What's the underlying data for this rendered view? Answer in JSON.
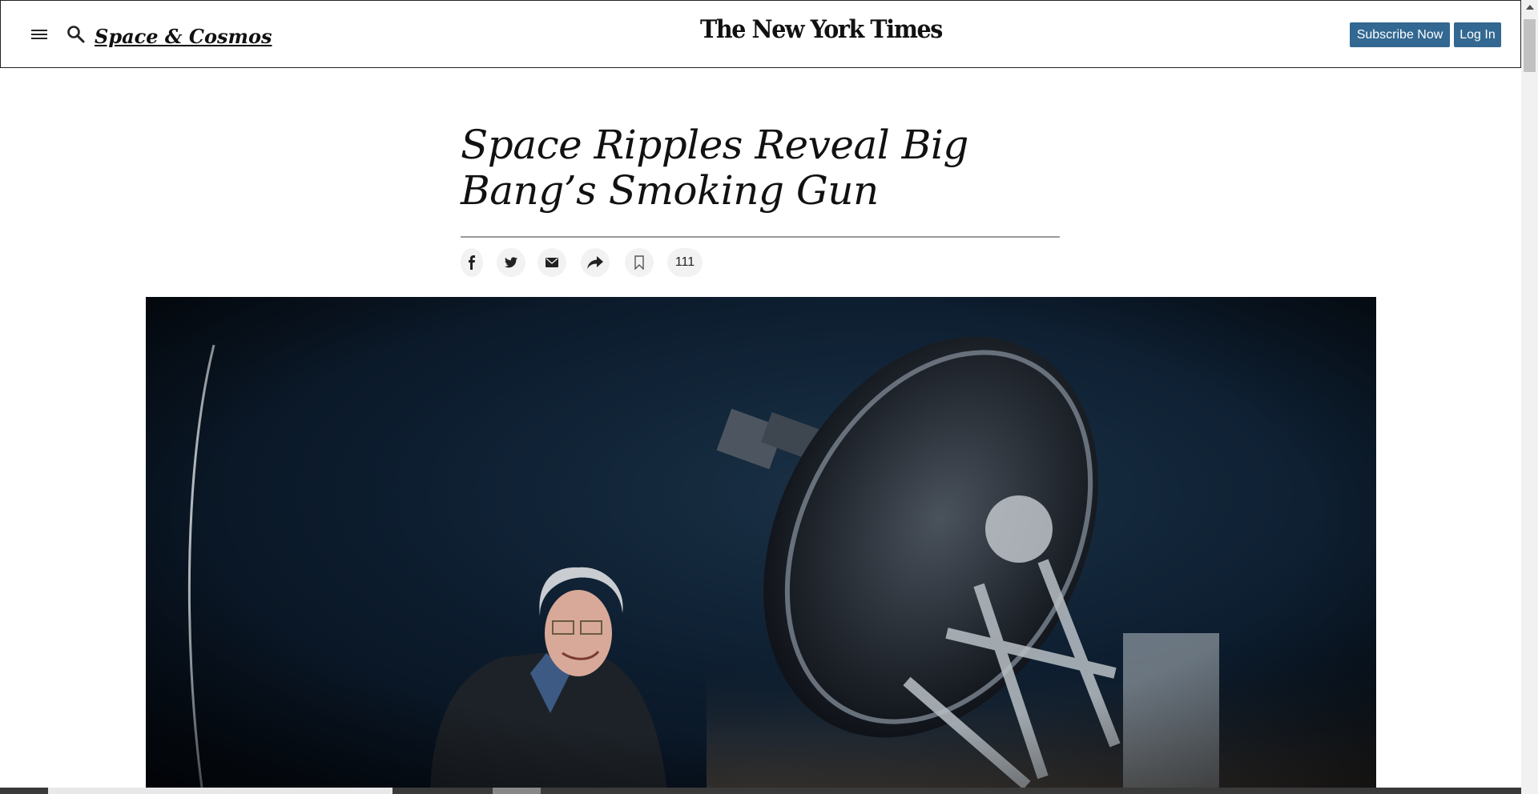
{
  "header": {
    "section_label": "Space & Cosmos",
    "logo_text": "The New York Times",
    "subscribe_label": "Subscribe Now",
    "login_label": "Log In"
  },
  "article": {
    "headline": "Space Ripples Reveal Big Bang’s Smoking Gun",
    "comment_count": "111"
  },
  "share": {
    "items": [
      {
        "name": "facebook",
        "icon": "facebook-icon"
      },
      {
        "name": "twitter",
        "icon": "twitter-icon"
      },
      {
        "name": "email",
        "icon": "email-icon"
      },
      {
        "name": "share",
        "icon": "share-arrow-icon"
      },
      {
        "name": "save",
        "icon": "bookmark-icon"
      }
    ]
  },
  "colors": {
    "button_bg": "#326891",
    "button_text": "#ffffff",
    "share_bg": "#f2f2f2"
  }
}
